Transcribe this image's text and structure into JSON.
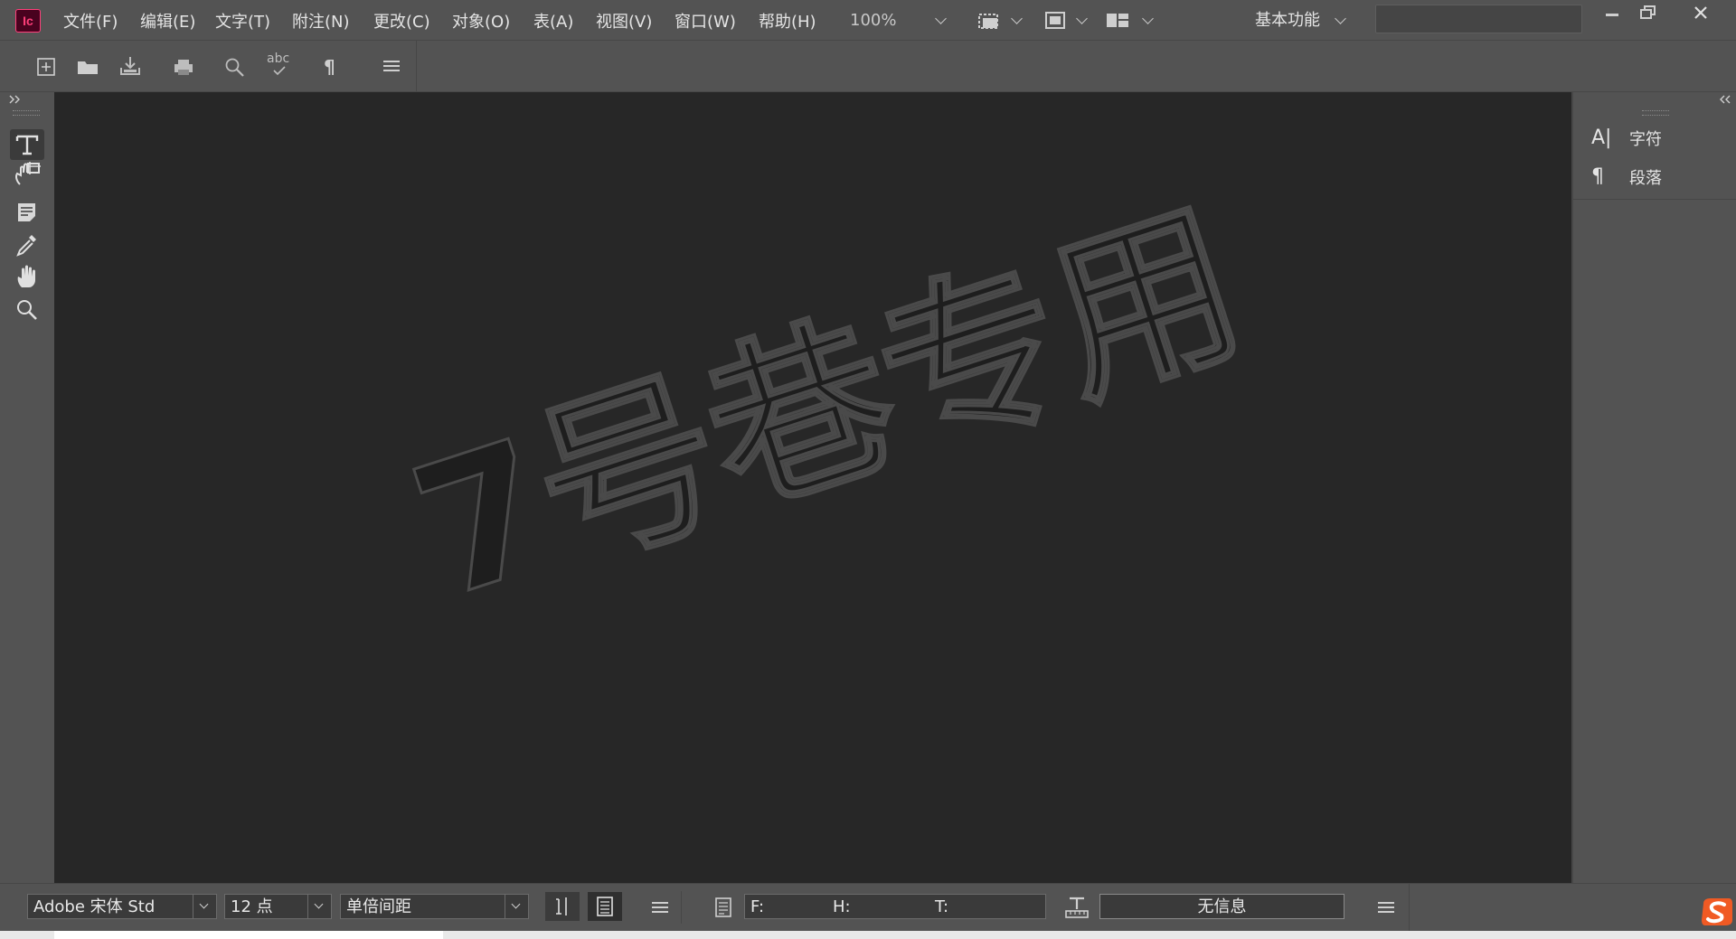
{
  "app": {
    "logo_text": "Ic",
    "accent": "#ff3f7a"
  },
  "menu": {
    "items": [
      "文件(F)",
      "编辑(E)",
      "文字(T)",
      "附注(N)",
      "更改(C)",
      "对象(O)",
      "表(A)",
      "视图(V)",
      "窗口(W)",
      "帮助(H)"
    ],
    "zoom": "100%",
    "workspace": "基本功能"
  },
  "toolbar": {
    "icons": [
      "new-document-icon",
      "open-folder-icon",
      "download-icon",
      "print-icon",
      "find-icon",
      "spellcheck-icon",
      "pilcrow-icon",
      "menu-icon"
    ],
    "spell_glyph": "abc",
    "pilcrow_glyph": "¶"
  },
  "tools": [
    "type-tool-icon",
    "position-tool-icon",
    "note-tool-icon",
    "eyedropper-tool-icon",
    "hand-tool-icon",
    "zoom-tool-icon"
  ],
  "right_panel": {
    "items": [
      {
        "icon": "A|",
        "label": "字符"
      },
      {
        "icon": "¶",
        "label": "段落"
      }
    ]
  },
  "canvas": {
    "watermark": "7号巷专用"
  },
  "status": {
    "font_family": "Adobe 宋体 Std",
    "font_size": "12 点",
    "line_spacing": "单倍间距",
    "f_label": "F:",
    "h_label": "H:",
    "t_label": "T:",
    "info": "无信息"
  }
}
